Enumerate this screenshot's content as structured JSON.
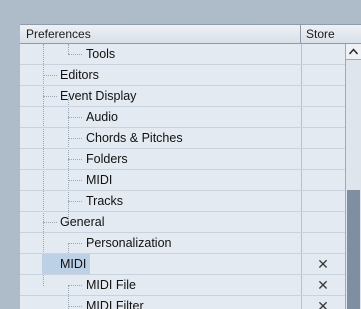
{
  "header": {
    "preferences_label": "Preferences",
    "store_label": "Store"
  },
  "tree": [
    {
      "label": "Tools",
      "store": ""
    },
    {
      "label": "Editors",
      "store": ""
    },
    {
      "label": "Event Display",
      "store": ""
    },
    {
      "label": "Audio",
      "store": ""
    },
    {
      "label": "Chords & Pitches",
      "store": ""
    },
    {
      "label": "Folders",
      "store": ""
    },
    {
      "label": "MIDI",
      "store": ""
    },
    {
      "label": "Tracks",
      "store": ""
    },
    {
      "label": "General",
      "store": ""
    },
    {
      "label": "Personalization",
      "store": ""
    },
    {
      "label": "MIDI",
      "store": "✕"
    },
    {
      "label": "MIDI File",
      "store": "✕"
    },
    {
      "label": "MIDI Filter",
      "store": "✕"
    }
  ],
  "icons": {
    "scroll_up": "chevron-up-icon"
  }
}
